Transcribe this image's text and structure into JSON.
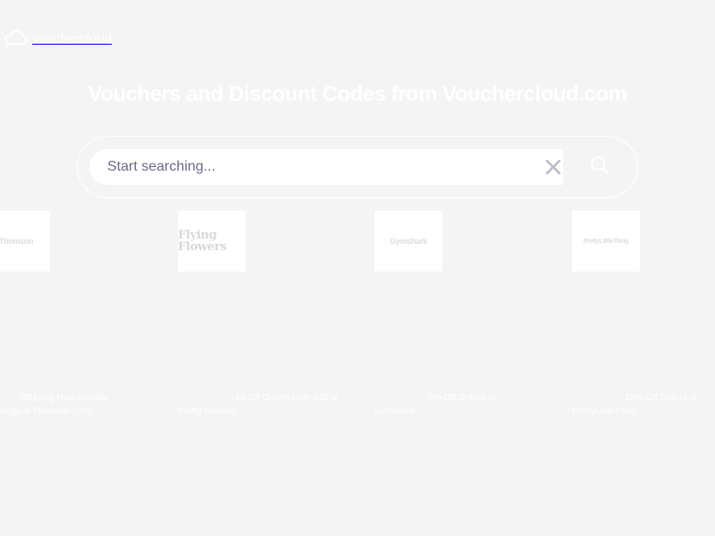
{
  "topbar": {
    "links": [
      "",
      "",
      "",
      "",
      ""
    ]
  },
  "brand": {
    "name": "vouchercloud"
  },
  "nav": {
    "items": [
      "",
      "",
      "",
      "",
      ""
    ]
  },
  "hero": {
    "title": "Vouchers and Discount Codes from Vouchercloud.com",
    "subtitle": ""
  },
  "search": {
    "placeholder": "Start searching...",
    "value": ""
  },
  "cards": [
    {
      "brand_logo": "Thomson",
      "title_line1": "Off Long Haul Holiday",
      "title_line2": "kings at Thomson (TUI)"
    },
    {
      "brand_logo": "Flying Flowers",
      "title_line1": "£5 Off Orders Over £50 at",
      "title_line2": "Flying Flowers"
    },
    {
      "brand_logo": "Gymshark",
      "title_line1": "5% Off Orders at",
      "title_line2": "Gymshark"
    },
    {
      "brand_logo": "PrettyLittleThing",
      "title_line1": "15% Off Orders at",
      "title_line2": "PrettyLittleThing"
    }
  ],
  "colors": {
    "background": "#f4f4f4",
    "text": "#ffffff",
    "placeholder": "#6a6a8a"
  }
}
